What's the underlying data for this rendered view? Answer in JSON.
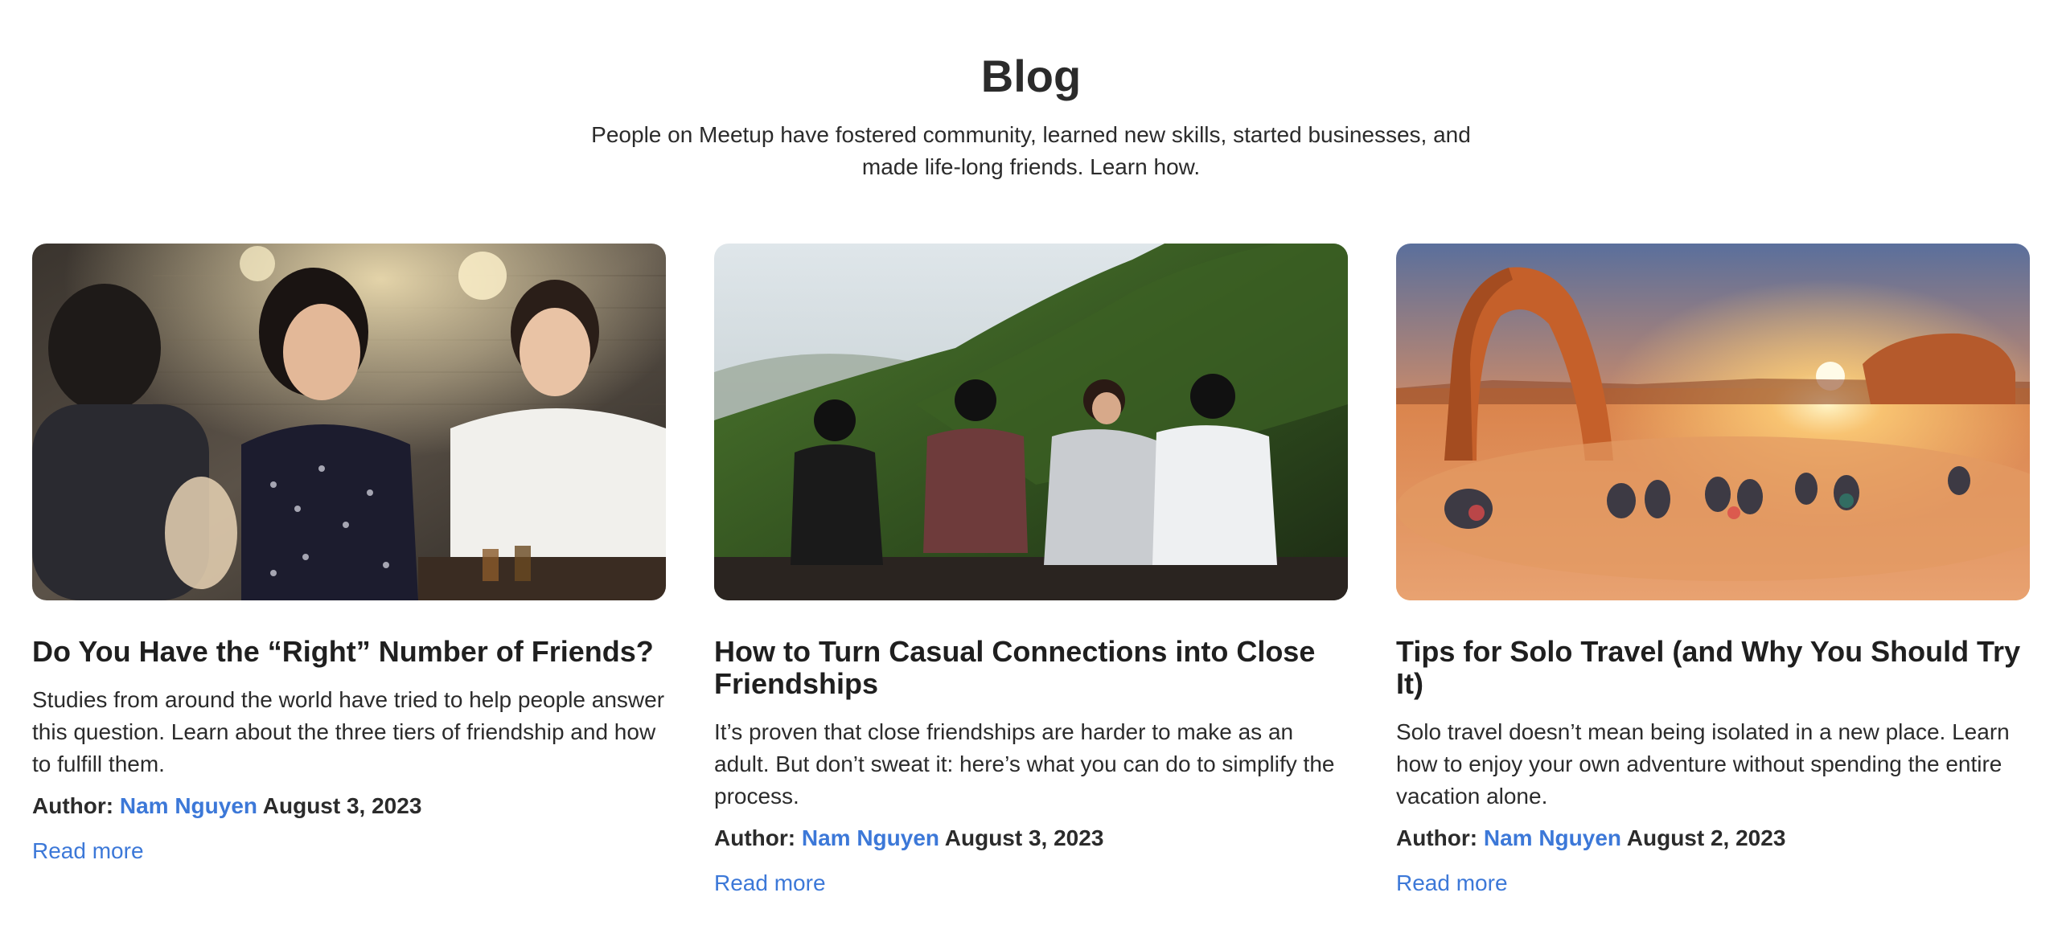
{
  "header": {
    "title": "Blog",
    "subtitle": "People on Meetup have fostered community, learned new skills, started businesses, and made life-long friends. Learn how."
  },
  "cards": [
    {
      "image": "friends-dining-photo",
      "title": "Do You Have the “Right” Number of Friends?",
      "description": "Studies from around the world have tried to help people answer this question. Learn about the three tiers of friendship and how to fulfill them.",
      "author_label": "Author:",
      "author": "Nam Nguyen",
      "date": "August 3, 2023",
      "read_more": "Read more"
    },
    {
      "image": "friends-on-hillside-photo",
      "title": "How to Turn Casual Connections into Close Friendships",
      "description": "It’s proven that close friendships are harder to make as an adult. But don’t sweat it: here’s what you can do to simplify the process.",
      "author_label": "Author:",
      "author": "Nam Nguyen",
      "date": "August 3, 2023",
      "read_more": "Read more"
    },
    {
      "image": "desert-arch-sunset-photo",
      "title": "Tips for Solo Travel (and Why You Should Try It)",
      "description": "Solo travel doesn’t mean being isolated in a new place. Learn how to enjoy your own adventure without spending the entire vacation alone.",
      "author_label": "Author:",
      "author": "Nam Nguyen",
      "date": "August 2, 2023",
      "read_more": "Read more"
    }
  ],
  "colors": {
    "link": "#3c78d8",
    "text": "#2b2b2b"
  }
}
